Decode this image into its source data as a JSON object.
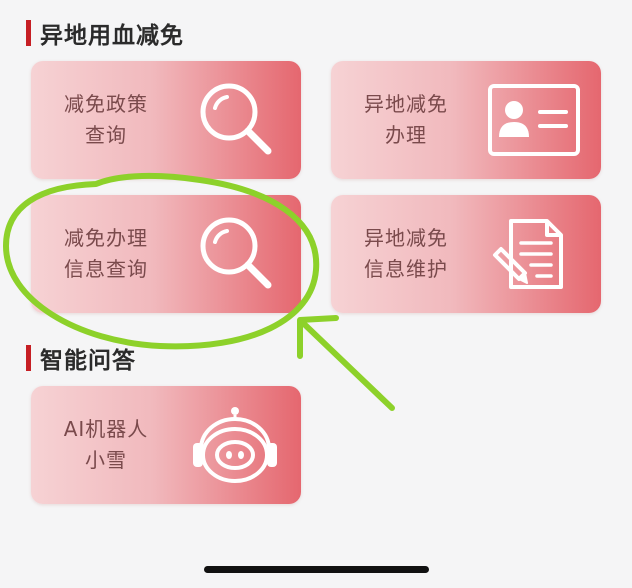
{
  "colors": {
    "accent": "#c61e24",
    "page_bg": "#f5f5f6",
    "tile_gradient_start": "#f6d2d4",
    "tile_gradient_end": "#e5676f",
    "annotation": "#8dd12a"
  },
  "sections": {
    "remote": {
      "title": "异地用血减免",
      "tiles": {
        "policy_query": {
          "line1": "减免政策",
          "line2": "查询",
          "icon": "magnifier-icon"
        },
        "remote_apply": {
          "line1": "异地减免",
          "line2": "办理",
          "icon": "id-card-icon"
        },
        "apply_info_query": {
          "line1": "减免办理",
          "line2": "信息查询",
          "icon": "magnifier-icon"
        },
        "info_maintain": {
          "line1": "异地减免",
          "line2": "信息维护",
          "icon": "document-edit-icon"
        }
      }
    },
    "qa": {
      "title": "智能问答",
      "tiles": {
        "ai_robot": {
          "line1": "AI机器人",
          "line2": "小雪",
          "icon": "robot-face-icon"
        }
      }
    }
  },
  "annotations": {
    "circle": "hand-drawn-circle",
    "arrow": "hand-drawn-arrow"
  }
}
